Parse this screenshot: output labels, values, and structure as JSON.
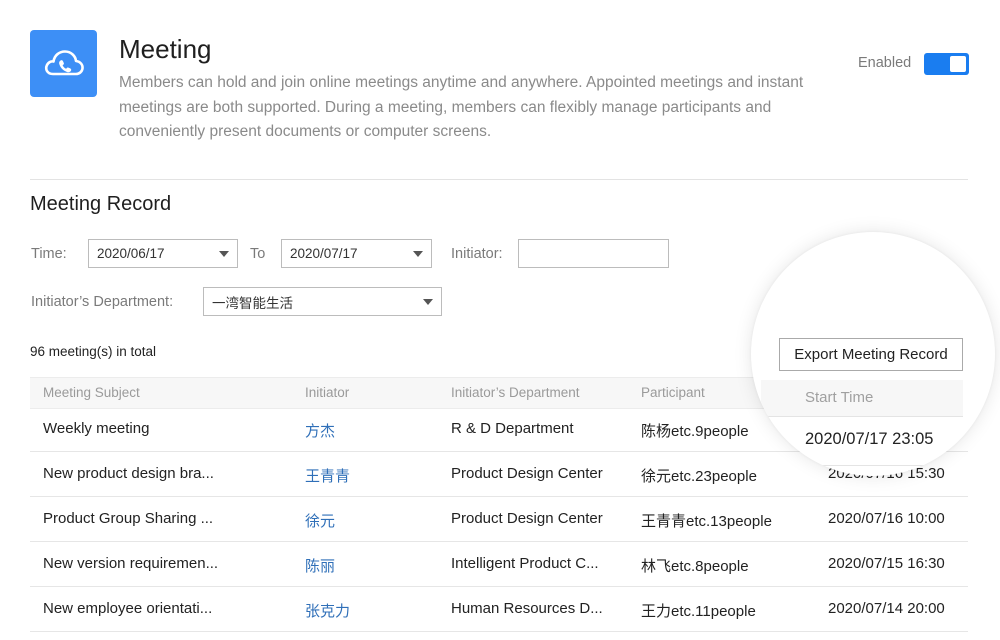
{
  "app": {
    "title": "Meeting",
    "description": "Members can hold and join online meetings anytime and anywhere. Appointed meetings and instant meetings are both supported. During a meeting, members can flexibly manage participants and conveniently present documents or computer screens.",
    "icon": "cloud-phone-icon",
    "enabled_label": "Enabled",
    "enabled": true
  },
  "record": {
    "section_title": "Meeting Record",
    "filters": {
      "time_label": "Time:",
      "from_date": "2020/06/17",
      "to_label": "To",
      "to_date": "2020/07/17",
      "initiator_label": "Initiator:",
      "initiator_value": "",
      "dept_label": "Initiator’s Department:",
      "dept_value": "一湾智能生活"
    },
    "total_text": "96 meeting(s) in total",
    "export_label": "Export Meeting Record",
    "columns": [
      "Meeting Subject",
      "Initiator",
      "Initiator’s Department",
      "Participant",
      "Start Time"
    ],
    "rows": [
      {
        "subject": "Weekly meeting",
        "initiator": "方杰",
        "dept": "R & D Department",
        "participant": "陈杨etc.9people",
        "start": "2020/07/17 23:05"
      },
      {
        "subject": "New product design bra...",
        "initiator": "王青青",
        "dept": "Product Design Center",
        "participant": "徐元etc.23people",
        "start": "2020/07/16 15:30"
      },
      {
        "subject": "Product Group Sharing ...",
        "initiator": "徐元",
        "dept": "Product Design Center",
        "participant": "王青青etc.13people",
        "start": "2020/07/16 10:00"
      },
      {
        "subject": "New version requiremen...",
        "initiator": "陈丽",
        "dept": "Intelligent Product C...",
        "participant": "林飞etc.8people",
        "start": "2020/07/15 16:30"
      },
      {
        "subject": "New employee orientati...",
        "initiator": "张克力",
        "dept": "Human Resources D...",
        "participant": "王力etc.11people",
        "start": "2020/07/14 20:00"
      }
    ]
  },
  "colors": {
    "accent": "#3d8ff6",
    "toggle": "#1a7df0",
    "link": "#2f6fb8"
  }
}
